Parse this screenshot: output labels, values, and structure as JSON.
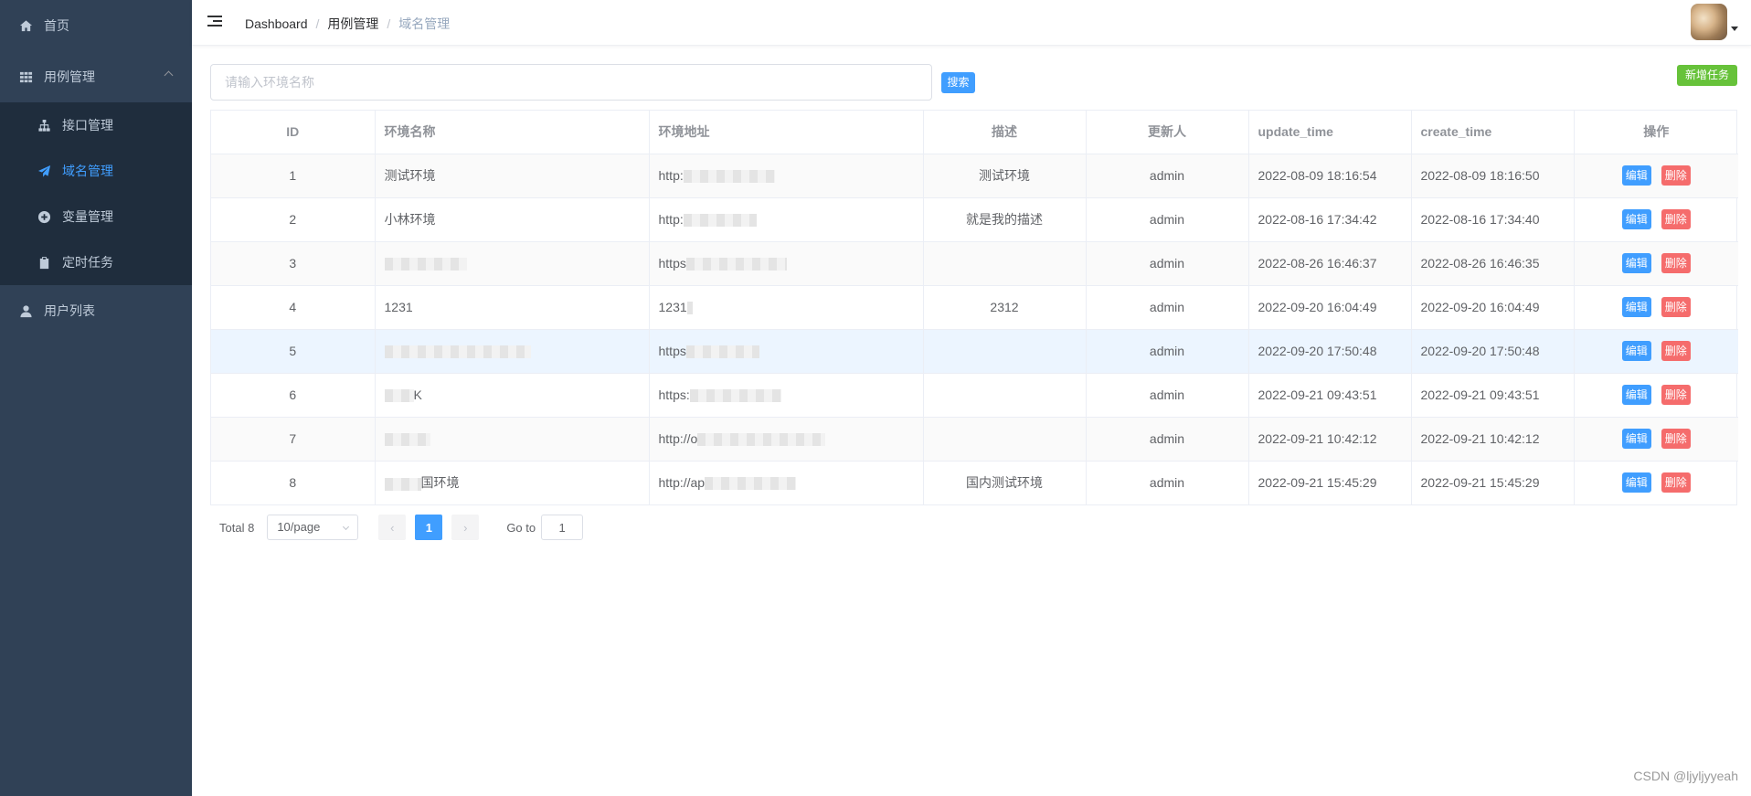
{
  "sidebar": {
    "home": {
      "label": "首页",
      "icon": "home-icon"
    },
    "case_mgmt": {
      "label": "用例管理",
      "icon": "grid-icon",
      "expanded": true
    },
    "submenu": [
      {
        "label": "接口管理",
        "icon": "sitemap-icon"
      },
      {
        "label": "域名管理",
        "icon": "paper-plane-icon",
        "active": true
      },
      {
        "label": "变量管理",
        "icon": "plus-circle-icon"
      },
      {
        "label": "定时任务",
        "icon": "clipboard-icon"
      }
    ],
    "users": {
      "label": "用户列表",
      "icon": "user-icon"
    },
    "colors": {
      "bg": "#304156",
      "submenu_bg": "#1f2d3d",
      "active": "#409eff",
      "text": "#bfcbd9"
    }
  },
  "breadcrumb": [
    "Dashboard",
    "用例管理",
    "域名管理"
  ],
  "search": {
    "placeholder": "请输入环境名称",
    "value": "",
    "button_label": "搜索"
  },
  "new_task_label": "新增任务",
  "table": {
    "headers": [
      "ID",
      "环境名称",
      "环境地址",
      "描述",
      "更新人",
      "update_time",
      "create_time",
      "操作"
    ],
    "edit_label": "编辑",
    "delete_label": "删除",
    "rows": [
      {
        "id": "1",
        "name": "测试环境",
        "url": "http:",
        "desc": "测试环境",
        "updater": "admin",
        "update_time": "2022-08-09 18:16:54",
        "create_time": "2022-08-09 18:16:50"
      },
      {
        "id": "2",
        "name": "小林环境",
        "url": "http:",
        "desc": "就是我的描述",
        "updater": "admin",
        "update_time": "2022-08-16 17:34:42",
        "create_time": "2022-08-16 17:34:40"
      },
      {
        "id": "3",
        "name": "",
        "url": "https",
        "desc": "",
        "updater": "admin",
        "update_time": "2022-08-26 16:46:37",
        "create_time": "2022-08-26 16:46:35"
      },
      {
        "id": "4",
        "name": "1231",
        "url": "1231",
        "desc": "2312",
        "updater": "admin",
        "update_time": "2022-09-20 16:04:49",
        "create_time": "2022-09-20 16:04:49"
      },
      {
        "id": "5",
        "name": "",
        "url": "https",
        "desc": "",
        "updater": "admin",
        "update_time": "2022-09-20 17:50:48",
        "create_time": "2022-09-20 17:50:48"
      },
      {
        "id": "6",
        "name": "K",
        "url": "https:",
        "desc": "",
        "updater": "admin",
        "update_time": "2022-09-21 09:43:51",
        "create_time": "2022-09-21 09:43:51"
      },
      {
        "id": "7",
        "name": "",
        "url": "http://o",
        "desc": "",
        "updater": "admin",
        "update_time": "2022-09-21 10:42:12",
        "create_time": "2022-09-21 10:42:12"
      },
      {
        "id": "8",
        "name": "国环境",
        "url": "http://ap",
        "desc": "国内测试环境",
        "updater": "admin",
        "update_time": "2022-09-21 15:45:29",
        "create_time": "2022-09-21 15:45:29"
      }
    ]
  },
  "pagination": {
    "total_label": "Total 8",
    "page_size": "10/page",
    "current_page": "1",
    "goto_label": "Go to",
    "goto_value": "1"
  },
  "watermark": "CSDN @ljyljyyeah"
}
